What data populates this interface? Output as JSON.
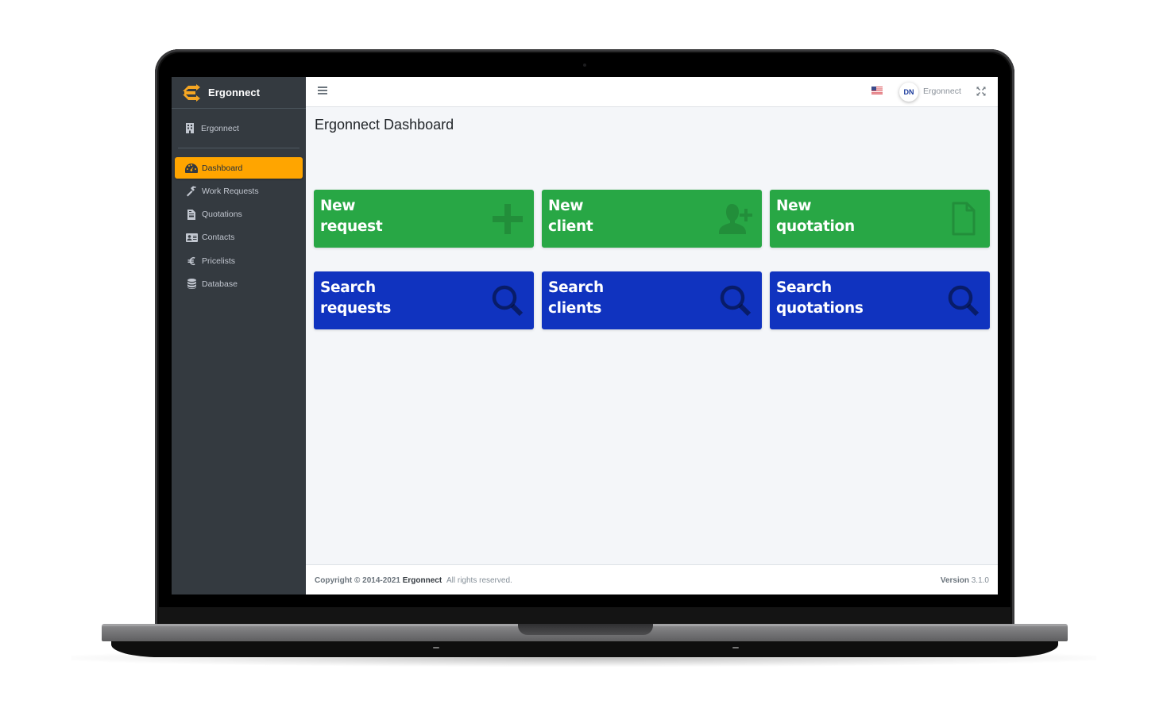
{
  "app": {
    "brand_name": "Ergonnect",
    "brand_color": "#ffa500"
  },
  "sidebar": {
    "user_panel": {
      "icon": "building-icon",
      "label": "Ergonnect"
    },
    "items": [
      {
        "label": "Dashboard",
        "icon": "tachometer-icon",
        "active": true
      },
      {
        "label": "Work Requests",
        "icon": "hammer-icon",
        "active": false
      },
      {
        "label": "Quotations",
        "icon": "file-invoice-icon",
        "active": false
      },
      {
        "label": "Contacts",
        "icon": "address-card-icon",
        "active": false
      },
      {
        "label": "Pricelists",
        "icon": "euro-icon",
        "active": false
      },
      {
        "label": "Database",
        "icon": "database-icon",
        "active": false
      }
    ]
  },
  "topbar": {
    "menu_icon": "hamburger-icon",
    "language_icon": "us-flag-icon",
    "avatar_initials": "DN",
    "username": "Ergonnect",
    "fullscreen_icon": "expand-icon"
  },
  "main": {
    "page_title": "Ergonnect Dashboard",
    "tiles": [
      {
        "line1": "New",
        "line2": "request",
        "icon": "plus-icon",
        "color": "#28a745"
      },
      {
        "line1": "New",
        "line2": "client",
        "icon": "user-plus-icon",
        "color": "#28a745"
      },
      {
        "line1": "New",
        "line2": "quotation",
        "icon": "file-icon",
        "color": "#28a745"
      },
      {
        "line1": "Search",
        "line2": "requests",
        "icon": "search-icon",
        "color": "#1033bf"
      },
      {
        "line1": "Search",
        "line2": "clients",
        "icon": "search-icon",
        "color": "#1033bf"
      },
      {
        "line1": "Search",
        "line2": "quotations",
        "icon": "search-icon",
        "color": "#1033bf"
      }
    ]
  },
  "footer": {
    "copyright_label": "Copyright © 2014-2021",
    "company": "Ergonnect",
    "rights": "All rights reserved.",
    "version_label": "Version",
    "version_value": "3.1.0"
  }
}
